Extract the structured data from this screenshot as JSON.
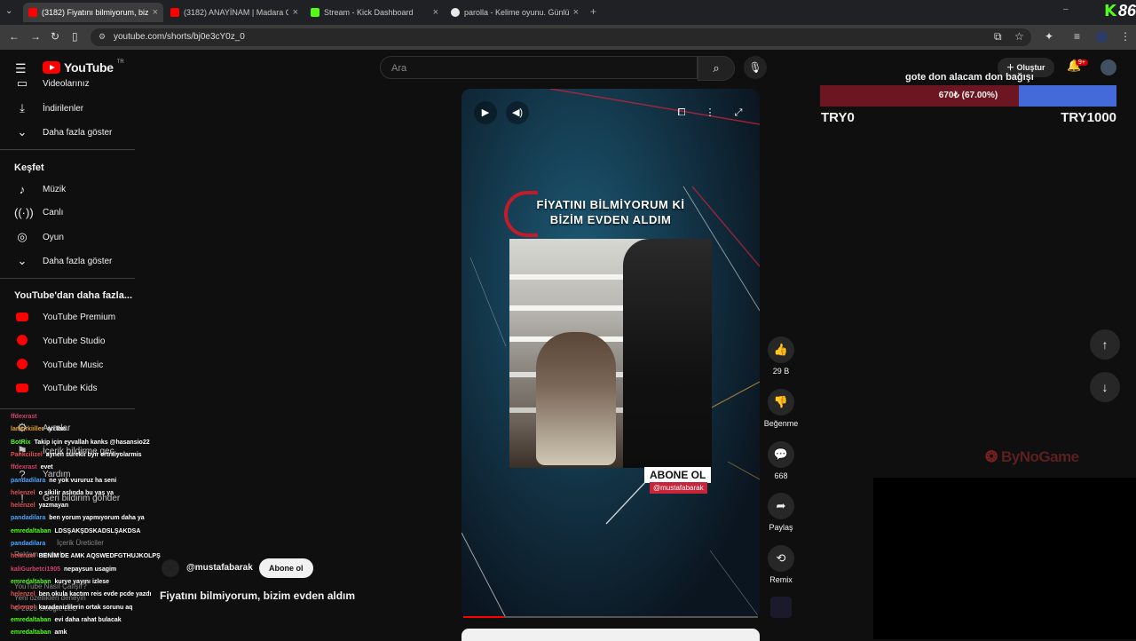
{
  "browser": {
    "tabs": [
      {
        "title": "(3182) Fiyatını bilmiyorum, bizim",
        "favicon_color": "#ff0000",
        "active": true
      },
      {
        "title": "(3182) ANAYİNAM | Madara Ol",
        "favicon_color": "#ff0000",
        "active": false
      },
      {
        "title": "Stream - Kick Dashboard",
        "favicon_color": "#53fc18",
        "active": false
      },
      {
        "title": "parolla - Kelime oyunu. Günlük",
        "favicon_color": "#e8e8e8",
        "active": false
      }
    ],
    "new_tab": "+",
    "url": "youtube.com/shorts/bj0e3cY0z_0",
    "corner_logo": "K",
    "corner_number": "86"
  },
  "youtube": {
    "logo_text": "YouTube",
    "logo_country": "TR",
    "search_placeholder": "Ara",
    "create_label": "Oluştur",
    "notif_badge": "9+"
  },
  "sidebar": {
    "top_items": [
      {
        "label": "Videolarınız",
        "icon": "video-icon"
      },
      {
        "label": "İndirilenler",
        "icon": "download-icon"
      },
      {
        "label": "Daha fazla göster",
        "icon": "chevron-down-icon"
      }
    ],
    "explore_heading": "Keşfet",
    "explore_items": [
      {
        "label": "Müzik",
        "icon": "music-icon"
      },
      {
        "label": "Canlı",
        "icon": "live-icon"
      },
      {
        "label": "Oyun",
        "icon": "gaming-icon"
      },
      {
        "label": "Daha fazla göster",
        "icon": "chevron-down-icon"
      }
    ],
    "more_heading": "YouTube'dan daha fazla...",
    "more_items": [
      {
        "label": "YouTube Premium"
      },
      {
        "label": "YouTube Studio"
      },
      {
        "label": "YouTube Music"
      },
      {
        "label": "YouTube Kids"
      }
    ],
    "settings_items": [
      {
        "label": "Ayarlar"
      },
      {
        "label": "İçerik bildirme geç..."
      },
      {
        "label": "Yardım"
      },
      {
        "label": "Geri bildirim gönder"
      }
    ],
    "footer_items": [
      "İçerik Üreticiler",
      "Reklam vermek",
      "Geliştiriciler",
      "YouTube Nasıl Çalışır?",
      "Yeni özellikleri deneyin",
      "© 2023 Google LLC"
    ]
  },
  "short": {
    "title_line1": "FİYATINI BİLMİYORUM Kİ",
    "title_line2": "BİZİM EVDEN ALDIM",
    "subscribe_overlay": "ABONE OL",
    "handle_overlay": "@mustafabarak",
    "progress": 0.14,
    "channel": "@mustafabarak",
    "subscribe_button": "Abone ol",
    "description": "Fiyatını bilmiyorum, bizim evden aldım"
  },
  "actions": {
    "likes": "29 B",
    "dislike": "Beğenme",
    "comments": "668",
    "share": "Paylaş",
    "remix": "Remix"
  },
  "donation": {
    "title": "gote don alacam don bağışı",
    "progress_text": "670₺ (67.00%)",
    "progress": 0.67,
    "min_label": "TRY0",
    "max_label": "TRY1000",
    "fill_color": "#6b1620",
    "bar_color": "#4469d8"
  },
  "brand_watermark": "ByNoGame",
  "chat": [
    {
      "user": "ffdexrast",
      "msg": "",
      "color": "#d0406a"
    },
    {
      "user": "lamorkiiller",
      "msg": "ari lan",
      "color": "#e6a030"
    },
    {
      "user": "BotRix",
      "msg": "Takip için eyvallah kanks @hasansio22",
      "color": "#53fc18"
    },
    {
      "user": "Pankcilizel",
      "msg": "aynen surekli byir ertriliyolarmis",
      "color": "#e05050"
    },
    {
      "user": "ffdexrast",
      "msg": "evet",
      "color": "#d0406a"
    },
    {
      "user": "pandadilara",
      "msg": "ne yok vururuz ha seni",
      "color": "#4aa3ff"
    },
    {
      "user": "helenzel",
      "msg": "o sikilir aslında bu yaş ya",
      "color": "#e05050"
    },
    {
      "user": "helenzel",
      "msg": "yazmayan",
      "color": "#e05050"
    },
    {
      "user": "pandadilara",
      "msg": "ben yorum yapmıyorum daha ya",
      "color": "#4aa3ff"
    },
    {
      "user": "emredaltaban",
      "msg": "LDSŞAKŞDSKADSLŞAKDSA",
      "color": "#53fc18"
    },
    {
      "user": "pandadilara",
      "msg": "",
      "color": "#4aa3ff"
    },
    {
      "user": "helenzel",
      "msg": "BENİM DE AMK AQSWEDFGTHUJKOLPŞ",
      "color": "#e05050"
    },
    {
      "user": "kaliGurbetci1905",
      "msg": "nepaysun usagim",
      "color": "#d0406a"
    },
    {
      "user": "emredaltaban",
      "msg": "kurye yayını izlese",
      "color": "#53fc18"
    },
    {
      "user": "helenzel",
      "msg": "ben okula kactım reis evde pcde yazdı",
      "color": "#e05050"
    },
    {
      "user": "helenzel",
      "msg": "karadenizlilerin ortak sorunu aq",
      "color": "#e05050"
    },
    {
      "user": "emredaltaban",
      "msg": "evi daha rahat bulacak",
      "color": "#53fc18"
    },
    {
      "user": "emredaltaban",
      "msg": "amk",
      "color": "#53fc18"
    }
  ]
}
